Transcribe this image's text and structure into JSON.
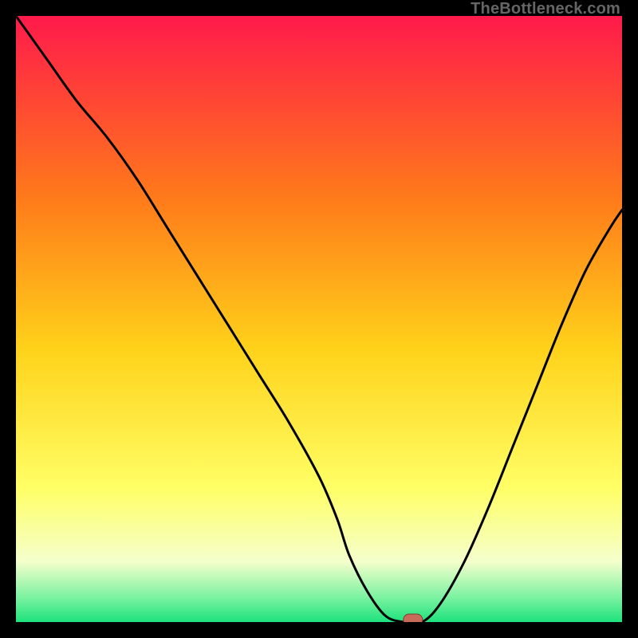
{
  "watermark": "TheBottleneck.com",
  "colors": {
    "frame": "#000000",
    "top": "#ff1a4b",
    "upper_mid": "#ff7a1a",
    "mid": "#ffd21a",
    "lower_mid": "#ffff66",
    "pale": "#f5ffcc",
    "green_light": "#7af2a0",
    "green": "#1de27d",
    "curve": "#000000",
    "marker_fill": "#c86b5b",
    "marker_stroke": "#7a3d33"
  },
  "chart_data": {
    "type": "line",
    "title": "",
    "xlabel": "",
    "ylabel": "",
    "xlim": [
      0,
      100
    ],
    "ylim": [
      0,
      100
    ],
    "series": [
      {
        "name": "bottleneck-curve",
        "x": [
          0,
          5,
          10,
          15,
          20,
          25,
          30,
          35,
          40,
          45,
          50,
          53,
          55,
          58,
          61,
          64,
          67,
          70,
          74,
          78,
          82,
          86,
          90,
          94,
          98,
          100
        ],
        "values": [
          100,
          93,
          86,
          80,
          73,
          65,
          57,
          49,
          41,
          33,
          24,
          17,
          11,
          5,
          1,
          0,
          0,
          3,
          10,
          19,
          29,
          39,
          49,
          58,
          65,
          68
        ]
      }
    ],
    "marker": {
      "x": 65.5,
      "y": 0
    },
    "gradient_stops": [
      {
        "pct": 0,
        "key": "top"
      },
      {
        "pct": 30,
        "key": "upper_mid"
      },
      {
        "pct": 55,
        "key": "mid"
      },
      {
        "pct": 78,
        "key": "lower_mid"
      },
      {
        "pct": 90,
        "key": "pale"
      },
      {
        "pct": 96,
        "key": "green_light"
      },
      {
        "pct": 100,
        "key": "green"
      }
    ]
  }
}
